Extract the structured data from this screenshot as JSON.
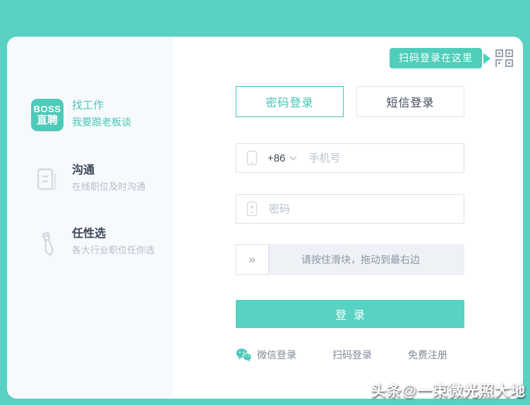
{
  "colors": {
    "accent": "#58d1c3",
    "accent_dark": "#41c6b3",
    "panel_bg": "#f7fafd",
    "text_dark": "#3c4757",
    "text_muted": "#b4bdc9",
    "link_gray": "#7f8a99"
  },
  "brand": {
    "logo_line1": "BOSS",
    "logo_line2": "直聘"
  },
  "sidebar": {
    "items": [
      {
        "title": "找工作",
        "subtitle": "我要跟老板谈"
      },
      {
        "title": "沟通",
        "subtitle": "在线职位及时沟通"
      },
      {
        "title": "任性选",
        "subtitle": "各大行业职位任你选"
      }
    ]
  },
  "qr_hint": {
    "label": "扫码登录在这里"
  },
  "tabs": [
    {
      "label": "密码登录",
      "active": true
    },
    {
      "label": "短信登录",
      "active": false
    }
  ],
  "form": {
    "country_code": "+86",
    "phone_placeholder": "手机号",
    "password_placeholder": "密码",
    "slider_handle": "»",
    "slider_text": "请按住滑块，拖动到最右边",
    "login_label": "登录"
  },
  "footer_links": [
    {
      "label": "微信登录"
    },
    {
      "label": "扫码登录"
    },
    {
      "label": "免费注册"
    }
  ],
  "watermark": "头条@一束微光照大地"
}
